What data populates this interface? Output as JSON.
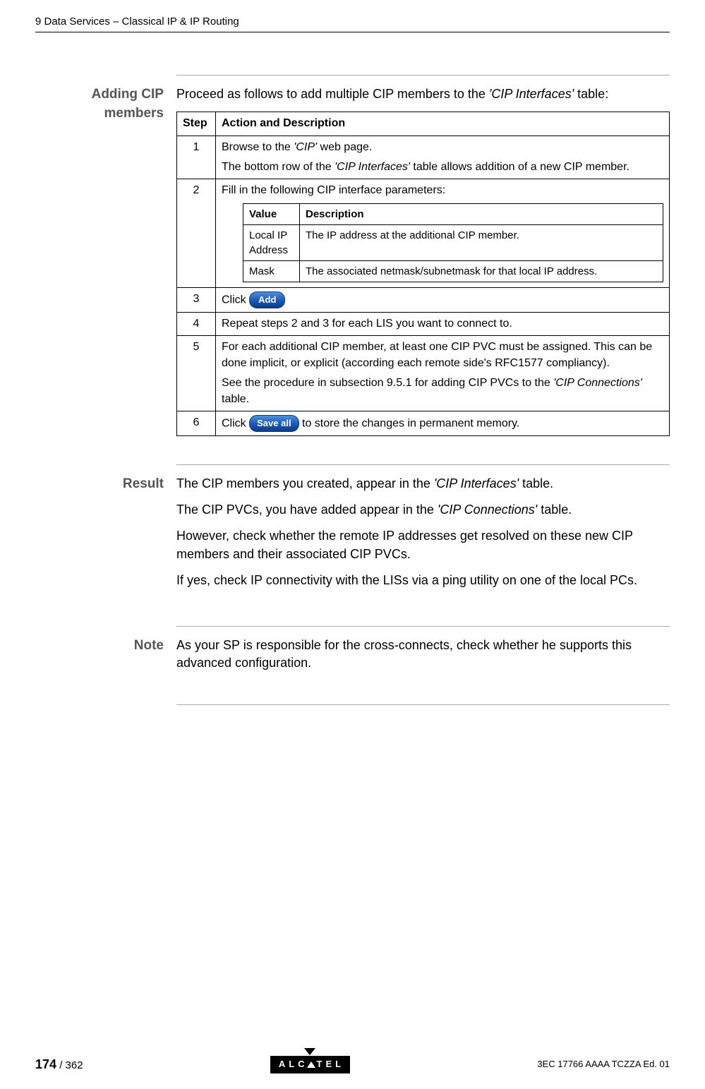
{
  "header": "9   Data Services – Classical IP & IP Routing",
  "sections": {
    "adding": {
      "label": "Adding CIP members",
      "intro_pre": "Proceed as follows to add multiple CIP members to the ",
      "intro_em": "'CIP Interfaces'",
      "intro_post": " table:",
      "table": {
        "head_step": "Step",
        "head_action": "Action and Description",
        "row1": {
          "num": "1",
          "line1_pre": "Browse to the ",
          "line1_em": "'CIP'",
          "line1_post": " web page.",
          "line2_pre": "The bottom row of the ",
          "line2_em": "'CIP Interfaces'",
          "line2_post": " table allows addition of a new CIP member."
        },
        "row2": {
          "num": "2",
          "intro": "Fill in the following CIP interface parameters:",
          "inner": {
            "head_value": "Value",
            "head_desc": "Description",
            "r1_value": "Local IP Address",
            "r1_desc": "The IP address at the additional CIP member.",
            "r2_value": "Mask",
            "r2_desc": "The associated netmask/subnetmask for that local IP address."
          }
        },
        "row3": {
          "num": "3",
          "click": "Click ",
          "btn": "Add"
        },
        "row4": {
          "num": "4",
          "text": "Repeat steps 2 and 3 for each LIS you want to connect to."
        },
        "row5": {
          "num": "5",
          "p1": "For each additional CIP member, at least one CIP PVC must be assigned. This can be done implicit, or explicit (according each remote side's RFC1577 compliancy).",
          "p2_pre": "See the procedure in subsection 9.5.1 for adding CIP PVCs to the ",
          "p2_em": "'CIP Connections'",
          "p2_post": " table."
        },
        "row6": {
          "num": "6",
          "click": "Click",
          "btn": "Save all",
          "post": "   to store the changes in permanent memory."
        }
      }
    },
    "result": {
      "label": "Result",
      "p1_pre": "The CIP members you created, appear in the ",
      "p1_em": "'CIP Interfaces'",
      "p1_post": " table.",
      "p2_pre": "The CIP PVCs, you have added appear in the ",
      "p2_em": "'CIP Connections'",
      "p2_post": " table.",
      "p3": "However, check whether the remote IP addresses get resolved on these new CIP members and their associated CIP PVCs.",
      "p4": "If yes, check IP connectivity with the LISs via a ping utility on one of the local PCs."
    },
    "note": {
      "label": "Note",
      "text": "As your SP is responsible for the cross-connects, check whether he supports this advanced configuration."
    }
  },
  "footer": {
    "page_bold": "174",
    "page_total": " / 362",
    "logo_left": "ALC",
    "logo_right": "TEL",
    "docid": "3EC 17766 AAAA TCZZA Ed. 01"
  }
}
